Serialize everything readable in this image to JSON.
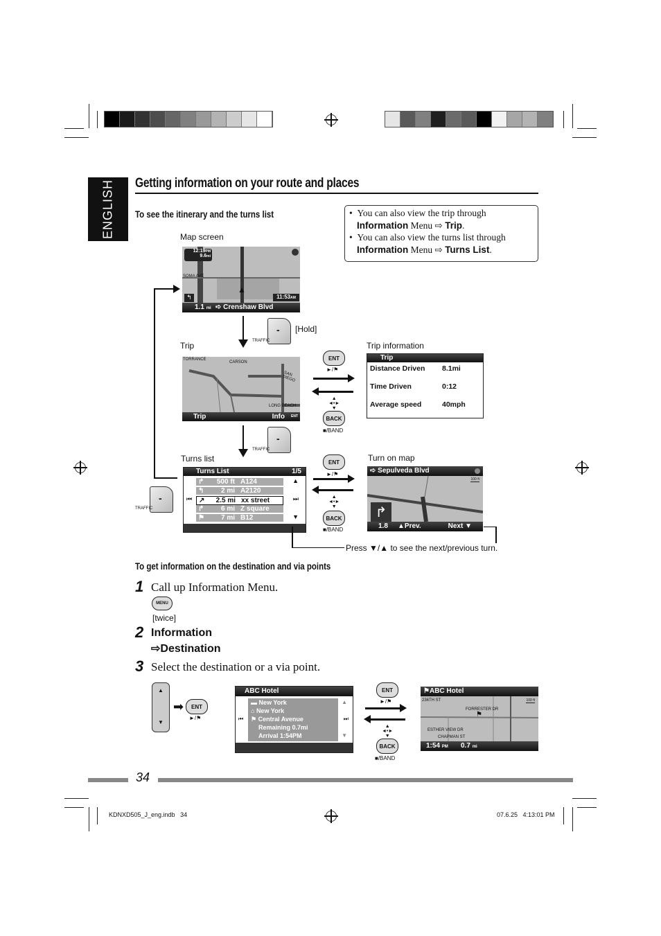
{
  "colors": {
    "ink": "#111111",
    "screen_gray": "#bdbdbd",
    "bar_dark": "#1a1a1a",
    "row_gray": "#aaaaaa",
    "rule_gray": "#888888"
  },
  "language_tab": "ENGLISH",
  "section_title": "Getting information on your route and places",
  "itinerary": {
    "heading": "To see the itinerary and the turns list",
    "note": {
      "items": [
        {
          "text": "You can also view the trip through",
          "bold1": "Information",
          "mid": "Menu",
          "arrow": "⇨",
          "bold2": "Trip",
          "end": "."
        },
        {
          "text": "You can also view the turns list through",
          "bold1": "Information",
          "mid": "Menu",
          "arrow": "⇨",
          "bold2": "Turns List",
          "end": "."
        }
      ]
    },
    "map_screen": {
      "label": "Map screen",
      "clock_top": "12:19",
      "clock_top_suffix": "PM",
      "dist_top": "9.6",
      "dist_top_unit": "mi",
      "street_left": "SOMA AVE",
      "clock_right": "11:53",
      "clock_right_suffix": "AM",
      "distance": "1.1",
      "distance_unit": "mi",
      "street": "Crenshaw Blvd"
    },
    "traffic_key": {
      "label": "TRAFFIC",
      "hold": "[Hold]"
    },
    "trip_screen": {
      "label": "Trip",
      "places": [
        "TORRANCE",
        "CARSON",
        "SAN DIEGO",
        "LONG BEACH"
      ],
      "left_button": "Trip",
      "right_button": "Info",
      "right_badge": "ENT"
    },
    "ent_button": {
      "label": "ENT",
      "caption": "►/⚑"
    },
    "back_button": {
      "label": "BACK",
      "caption": "■/BAND"
    },
    "trip_info": {
      "label": "Trip information",
      "header": "Trip",
      "rows": [
        {
          "name": "Distance Driven",
          "value": "8.1mi"
        },
        {
          "name": "Time Driven",
          "value": "0:12"
        },
        {
          "name": "Average speed",
          "value": "40mph"
        }
      ]
    },
    "turns_list": {
      "label": "Turns list",
      "header": "Turns List",
      "page": "1/5",
      "rows": [
        {
          "icon": "↱",
          "dist": "500 ft",
          "road": "A124",
          "selected": false
        },
        {
          "icon": "↰",
          "dist": "2 mi",
          "road": "A2120",
          "selected": false
        },
        {
          "icon": "↗",
          "dist": "2.5 mi",
          "road": "xx street",
          "selected": true
        },
        {
          "icon": "↱",
          "dist": "6 mi",
          "road": "Z square",
          "selected": false
        },
        {
          "icon": "⚑",
          "dist": "7 mi",
          "road": "B12",
          "selected": false
        }
      ]
    },
    "turn_on_map": {
      "label": "Turn on map",
      "street": "Sepulveda Blvd",
      "scale": "100 ft",
      "distance": "1.8",
      "prev": "Prev.",
      "next": "Next"
    },
    "press_note": {
      "prefix": "Press",
      "symbols": "▼/▲",
      "suffix": "to see the next/previous turn."
    }
  },
  "destination": {
    "heading": "To get information on the destination and via points",
    "steps": [
      {
        "num": "1",
        "text": "Call up Information Menu.",
        "button": "MENU",
        "note": "[twice]"
      },
      {
        "num": "2",
        "line1": "Information",
        "line2": "⇨Destination"
      },
      {
        "num": "3",
        "text": "Select the destination or a via point."
      }
    ],
    "list_screen": {
      "header": "ABC Hotel",
      "lines": [
        "New York",
        "New York",
        "Central Avenue",
        "Remaining 0.7mi",
        "Arrival 1:54PM"
      ]
    },
    "map_screen": {
      "header": "ABC Hotel",
      "streets": [
        "236TH ST",
        "FORRESTER DR",
        "ESTHER VIEW DR",
        "CHAPMAN ST"
      ],
      "scale": "100 ft",
      "time": "1:54",
      "time_suffix": "PM",
      "distance": "0.7",
      "distance_unit": "mi"
    }
  },
  "footer": {
    "page_number": "34",
    "file": "KDNXD505_J_eng.indb   34",
    "timestamp": "07.6.25   4:13:01 PM"
  },
  "calibration": {
    "left_bars": [
      "#000000",
      "#1a1a1a",
      "#333333",
      "#4d4d4d",
      "#666666",
      "#808080",
      "#999999",
      "#b3b3b3",
      "#cccccc",
      "#e6e6e6",
      "#ffffff"
    ],
    "right_bars": [
      "#e6e6e6",
      "#5a5a5a",
      "#808080",
      "#1f1f1f",
      "#6b6b6b",
      "#5a5a5a",
      "#000000",
      "#f2f2f2",
      "#a6a6a6",
      "#b3b3b3",
      "#808080"
    ]
  }
}
